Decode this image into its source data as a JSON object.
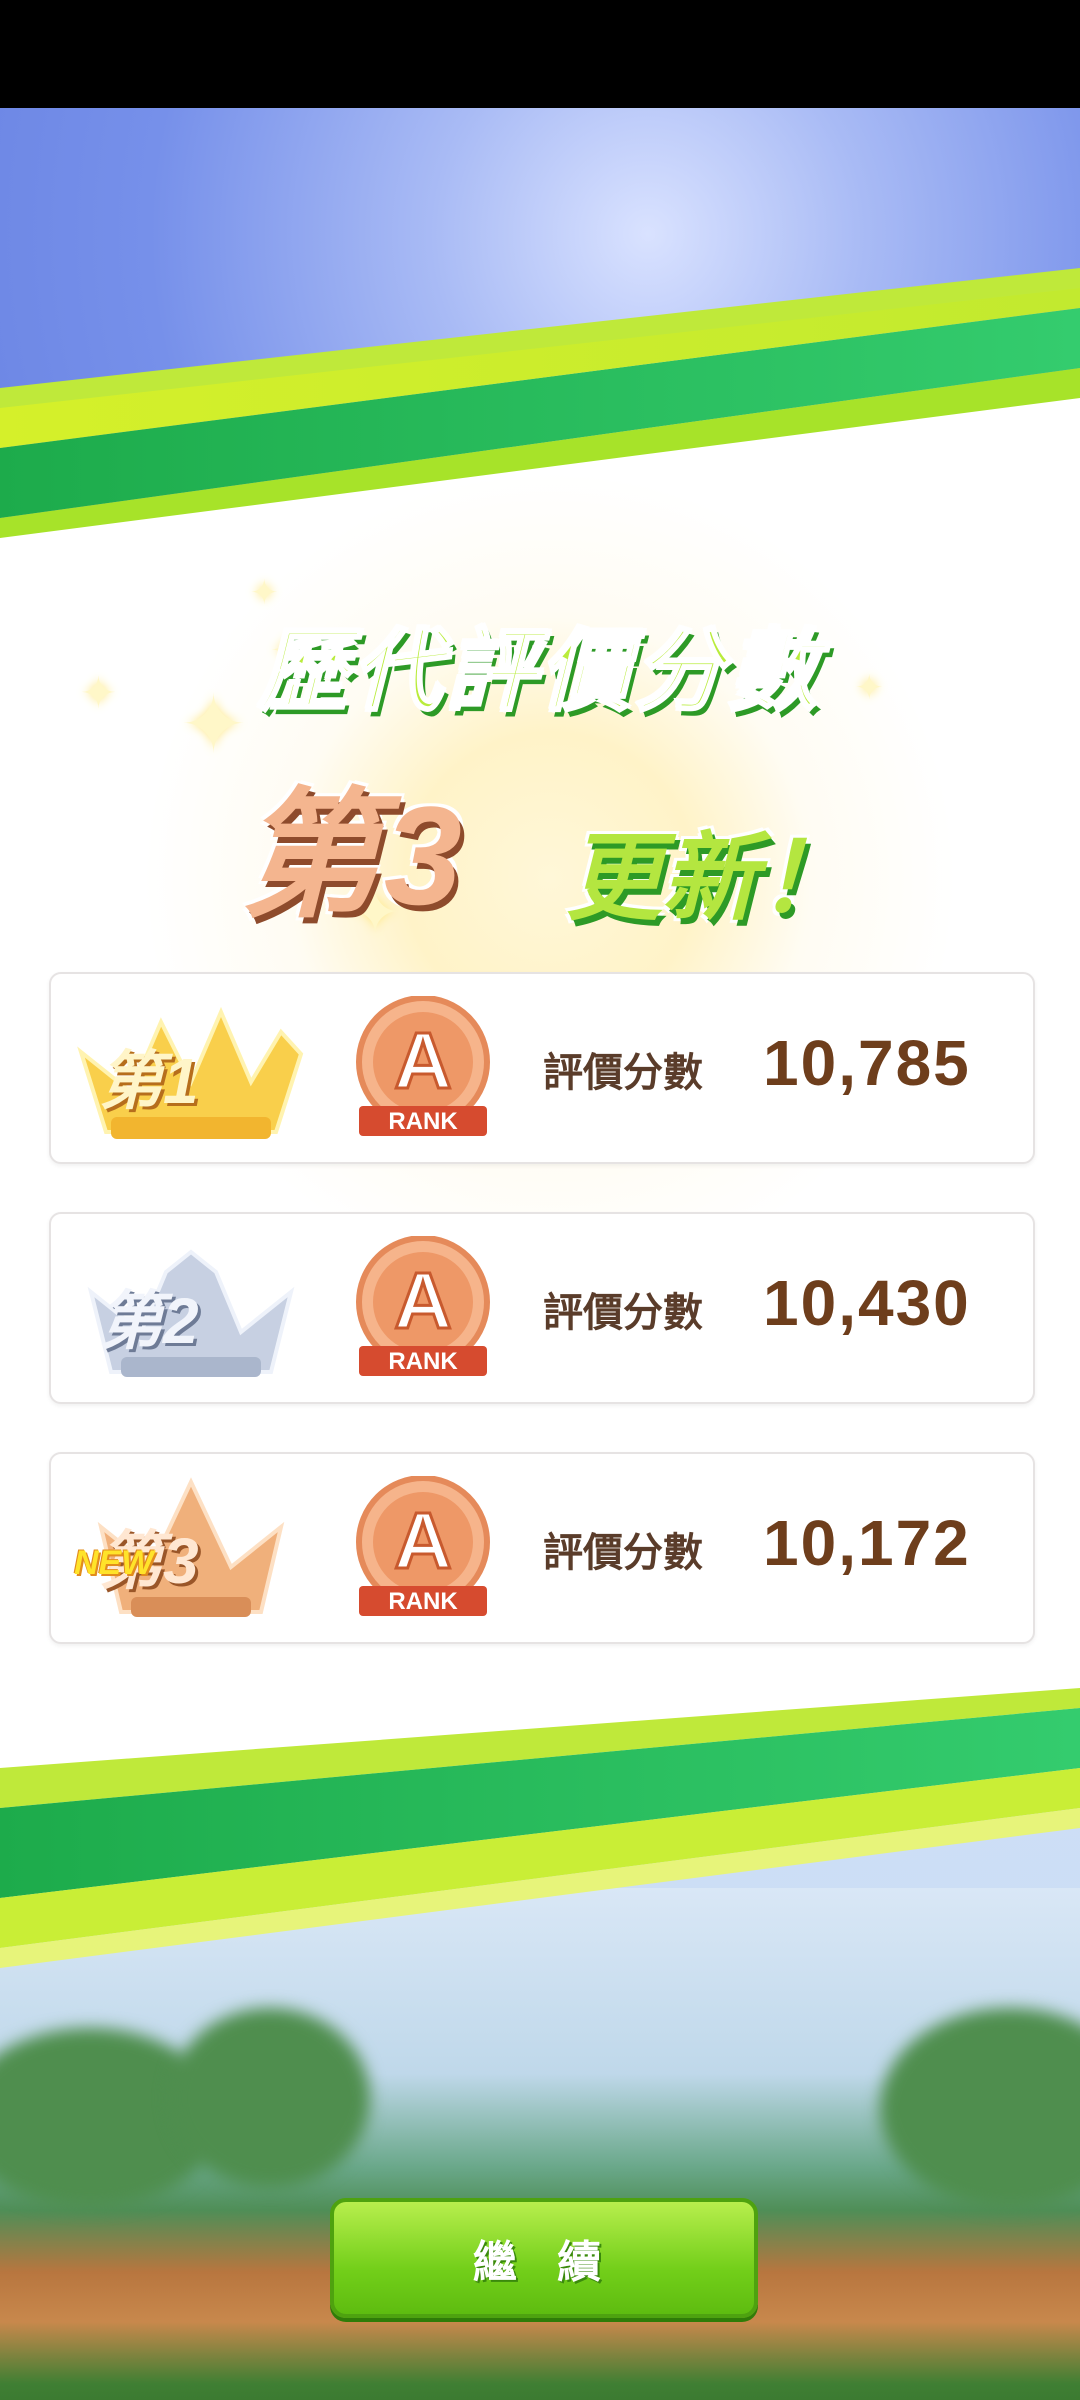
{
  "title": "歷代評價分數",
  "rank_number": "第3",
  "update_text": "更新！",
  "ranks": [
    {
      "place": "第1",
      "grade": "A",
      "grade_sub": "RANK",
      "score_label": "評價分數",
      "score": "10,785",
      "new": false
    },
    {
      "place": "第2",
      "grade": "A",
      "grade_sub": "RANK",
      "score_label": "評價分數",
      "score": "10,430",
      "new": false
    },
    {
      "place": "第3",
      "grade": "A",
      "grade_sub": "RANK",
      "score_label": "評價分數",
      "score": "10,172",
      "new": true,
      "new_label": "NEW"
    }
  ],
  "continue_label": "繼 續",
  "colors": {
    "accent_green": "#7ad222",
    "stripe_lime": "#c7ee2f",
    "score_brown": "#6e3e1c",
    "gold": "#f7c84a",
    "silver": "#b7c2d8",
    "bronze": "#e9a06b"
  }
}
